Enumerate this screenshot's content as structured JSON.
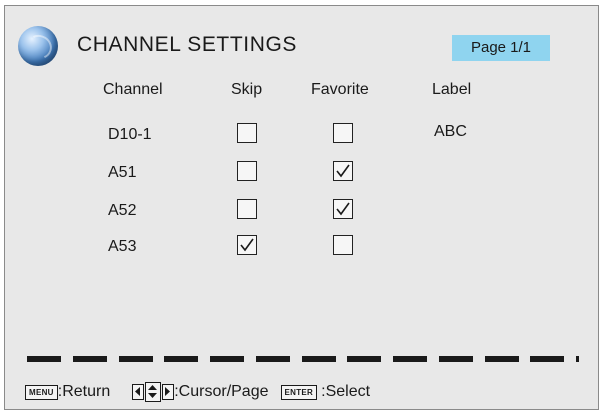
{
  "header": {
    "title": "CHANNEL SETTINGS",
    "page_indicator": "Page 1/1",
    "logo_icon": "globe-icon"
  },
  "table": {
    "columns": [
      "Channel",
      "Skip",
      "Favorite",
      "Label"
    ],
    "rows": [
      {
        "channel": "D10-1",
        "skip": false,
        "favorite": false,
        "label": "ABC"
      },
      {
        "channel": "A51",
        "skip": false,
        "favorite": true,
        "label": ""
      },
      {
        "channel": "A52",
        "skip": false,
        "favorite": true,
        "label": ""
      },
      {
        "channel": "A53",
        "skip": true,
        "favorite": false,
        "label": ""
      }
    ]
  },
  "footer": {
    "menu_key": "MENU",
    "menu_action": ":Return",
    "nav_action": ":Cursor/Page",
    "enter_key": "ENTER",
    "enter_action": ":Select"
  },
  "colors": {
    "background": "#e8e8e8",
    "page_badge": "#8fd4ef",
    "text": "#1a1a1a"
  }
}
